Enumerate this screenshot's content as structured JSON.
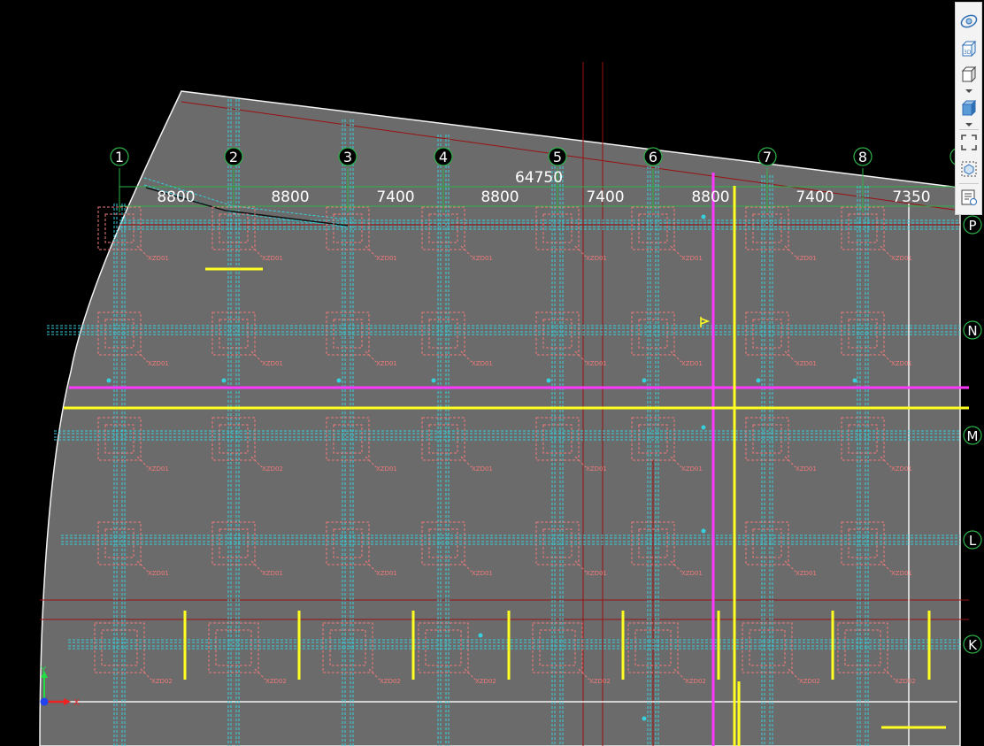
{
  "drawing": {
    "total_dimension": "64750",
    "column_grid": [
      {
        "label": "1"
      },
      {
        "label": "2"
      },
      {
        "label": "3"
      },
      {
        "label": "4"
      },
      {
        "label": "5"
      },
      {
        "label": "6"
      },
      {
        "label": "7"
      },
      {
        "label": "8"
      }
    ],
    "row_grid": [
      {
        "label": "P"
      },
      {
        "label": "N"
      },
      {
        "label": "M"
      },
      {
        "label": "L"
      },
      {
        "label": "K"
      }
    ],
    "spans": [
      "8800",
      "8800",
      "7400",
      "8800",
      "7400",
      "8800",
      "7400",
      "7350"
    ],
    "footing_tags": [
      [
        "XZD01",
        "XZD01",
        "XZD01",
        "XZD01",
        "XZD01",
        "XZD01",
        "XZD01",
        "XZD01"
      ],
      [
        "XZD01",
        "XZD01",
        "XZD01",
        "XZD01",
        "XZD01",
        "XZD01",
        "XZD01",
        "XZD01"
      ],
      [
        "XZD01",
        "XZD02",
        "XZD01",
        "XZD01",
        "XZD01",
        "XZD01",
        "XZD01",
        "XZD01"
      ],
      [
        "XZD01",
        "XZD01",
        "XZD01",
        "XZD01",
        "XZD01",
        "XZD01",
        "XZD01",
        "XZD01"
      ],
      [
        "XZD02",
        "XZD02",
        "XZD02",
        "XZD02",
        "XZD02",
        "XZD02",
        "XZD02",
        "XZD02"
      ]
    ],
    "axis": {
      "x_label": "X",
      "y_label": "Y"
    },
    "colors": {
      "slab": "#6b6b6b",
      "grid": "#2db34a",
      "beam": "#35d0dc",
      "footing": "#f07a7a",
      "magenta": "#ff38ff",
      "yellow": "#ffff22",
      "darkred": "#9a1010",
      "dimension_text": "#ffffff"
    }
  },
  "toolbar": {
    "items": [
      {
        "icon": "orbit-icon"
      },
      {
        "icon": "3d-view-icon"
      },
      {
        "icon": "view-cube-icon"
      },
      {
        "icon": "shaded-cube-icon"
      },
      {
        "icon": "zoom-extents-icon"
      },
      {
        "icon": "isolate-objects-icon"
      },
      {
        "icon": "properties-list-icon"
      }
    ]
  }
}
